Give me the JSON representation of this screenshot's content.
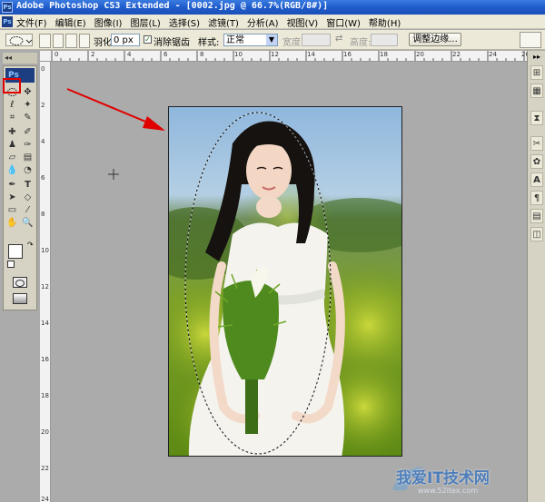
{
  "window": {
    "title": "Adobe Photoshop CS3 Extended - [0002.jpg @ 66.7%(RGB/8#)]",
    "app_badge": "Ps"
  },
  "menu": [
    "文件(F)",
    "编辑(E)",
    "图像(I)",
    "图层(L)",
    "选择(S)",
    "滤镜(T)",
    "分析(A)",
    "视图(V)",
    "窗口(W)",
    "帮助(H)"
  ],
  "options": {
    "feather_label": "羽化:",
    "feather_value": "0 px",
    "antialias_label": "消除锯齿",
    "style_label": "样式:",
    "style_value": "正常",
    "width_label": "宽度:",
    "height_label": "高度:",
    "adjust_edge": "调整边缘..."
  },
  "toolbox": {
    "logo": "Ps"
  },
  "ruler_top": [
    "0",
    "2",
    "4",
    "6",
    "8",
    "10",
    "12",
    "14",
    "16",
    "18",
    "20",
    "22",
    "24",
    "26"
  ],
  "ruler_left": [
    "0",
    "2",
    "4",
    "6",
    "8",
    "10",
    "12",
    "14",
    "16",
    "18",
    "20",
    "22",
    "24"
  ],
  "colors": {
    "highlight": "#e00000",
    "arrow": "#e00000",
    "titlebar": "#1f5ccc"
  },
  "watermark": {
    "text": "我爱IT技术网",
    "url": "www.52itex.com"
  }
}
